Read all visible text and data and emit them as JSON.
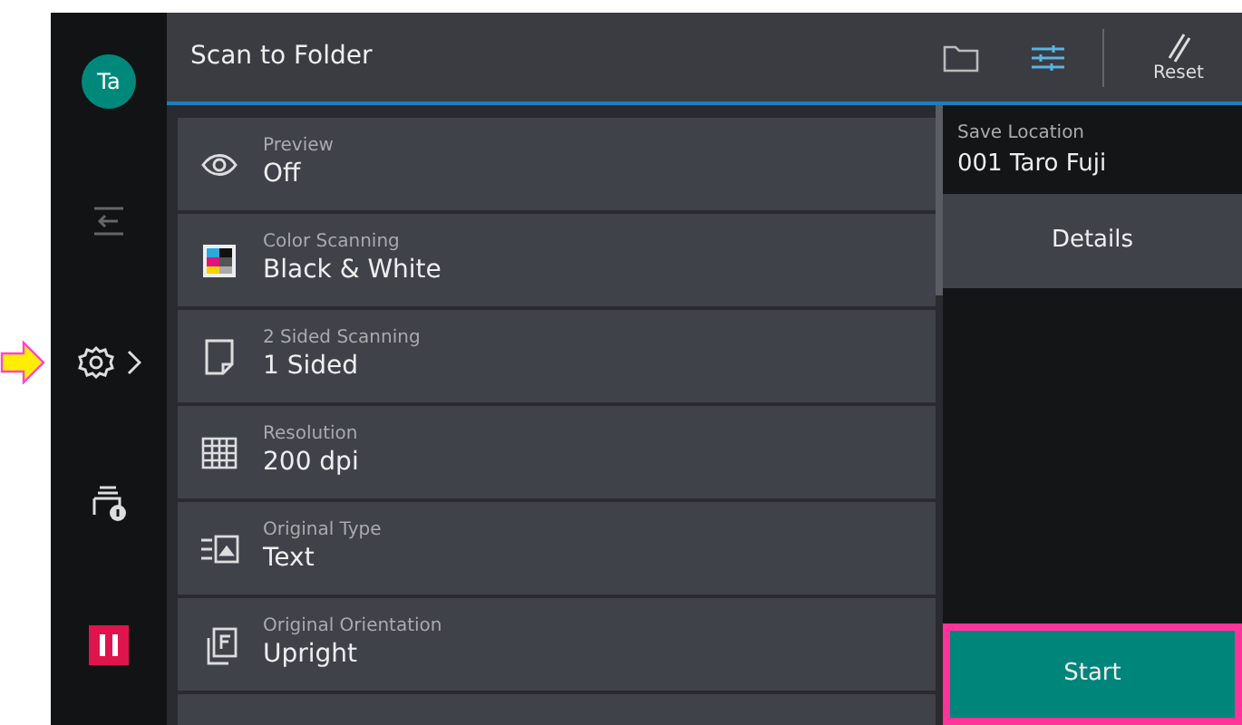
{
  "sidebar": {
    "items": [
      {
        "kind": "avatar",
        "text": "Ta",
        "selected": false,
        "pointed": false
      },
      {
        "kind": "transfer",
        "selected": false,
        "pointed": false
      },
      {
        "kind": "settings",
        "selected": true,
        "pointed": true
      },
      {
        "kind": "printer-info",
        "selected": false,
        "pointed": false
      },
      {
        "kind": "pause",
        "selected": false,
        "pointed": false
      }
    ]
  },
  "header": {
    "title": "Scan to Folder",
    "tools": [
      {
        "kind": "folder"
      },
      {
        "kind": "sliders"
      }
    ],
    "reset": {
      "label": "Reset"
    }
  },
  "features": [
    {
      "kind": "eye",
      "label": "Preview",
      "value": "Off"
    },
    {
      "kind": "color",
      "label": "Color Scanning",
      "value": "Black & White"
    },
    {
      "kind": "sides",
      "label": "2 Sided Scanning",
      "value": "1 Sided"
    },
    {
      "kind": "grid",
      "label": "Resolution",
      "value": "200 dpi"
    },
    {
      "kind": "type",
      "label": "Original Type",
      "value": "Text"
    },
    {
      "kind": "orientation",
      "label": "Original Orientation",
      "value": "Upright"
    },
    {
      "kind": "blank"
    }
  ],
  "save_location": {
    "label": "Save Location",
    "value": "001 Taro Fuji"
  },
  "details_button": {
    "label": "Details"
  },
  "start_button": {
    "label": "Start",
    "highlighted": true
  }
}
